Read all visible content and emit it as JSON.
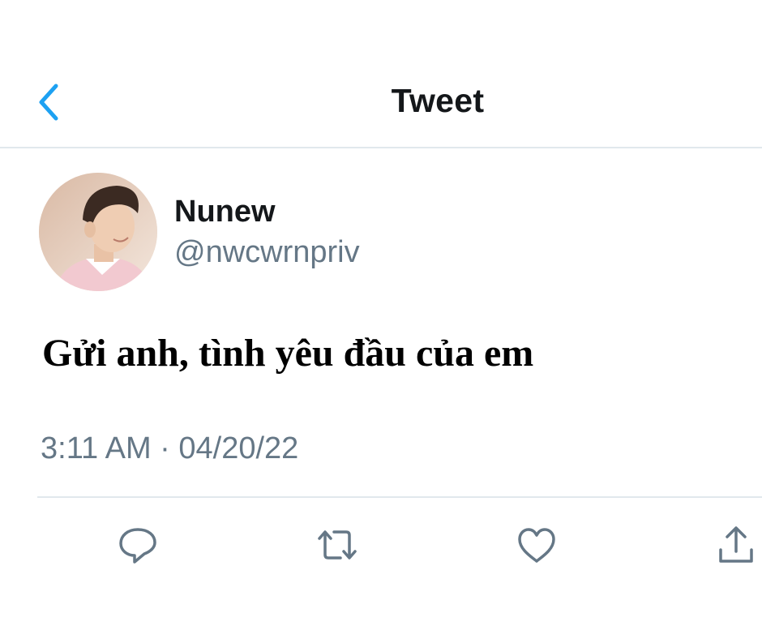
{
  "header": {
    "title": "Tweet",
    "back_icon": "chevron-left-icon",
    "accent_color": "#1da1f2"
  },
  "author": {
    "name": "Nunew",
    "handle": "@nwcwrnpriv"
  },
  "tweet": {
    "text": "Gửi anh, tình yêu đầu của em",
    "timestamp": "3:11 AM · 04/20/22"
  },
  "actions": [
    {
      "icon": "reply-icon"
    },
    {
      "icon": "retweet-icon"
    },
    {
      "icon": "like-icon"
    },
    {
      "icon": "share-icon"
    }
  ],
  "colors": {
    "primary_text": "#14171a",
    "secondary_text": "#657786",
    "divider": "#e1e8ed",
    "icon": "#657786"
  }
}
